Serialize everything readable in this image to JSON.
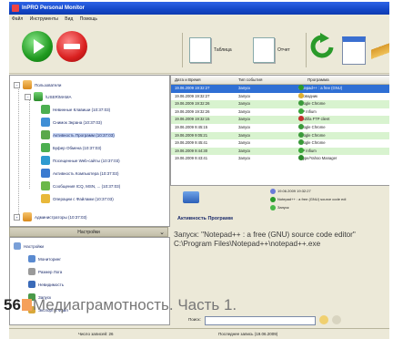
{
  "window": {
    "title": "InPRO Personal Monitor"
  },
  "menu": [
    "Файл",
    "Инструменты",
    "Вид",
    "Помощь"
  ],
  "toolbar": {
    "table_label": "Таблица",
    "report_label": "Отчет"
  },
  "tree": {
    "root": "Пользователи",
    "user": "\\USER\\МАМА",
    "items": [
      "Невинные Клавиши (10:37:03)",
      "Снимок Экрана (10:37:03)",
      "Активность Программ (10:37:03)",
      "Буфер Обмена (10:37:03)",
      "Посещенные Web-сайты (10:37:03)",
      "Активность Компьютера (10:37:03)",
      "Сообщения ICQ, MSN, ... (10:37:03)",
      "Операции с Файлами (10:37:03)"
    ],
    "admin": "Администраторы (10:37:03)"
  },
  "grid": {
    "columns": [
      "Дата и Время",
      "Тип события",
      "Программа"
    ],
    "rows": [
      {
        "date": "19.06.2009 19:32:27",
        "type": "Запуск",
        "program": "Notepad++ : a free (GNU)",
        "color": "#2a9a2a",
        "selected": true
      },
      {
        "date": "19.06.2009 19:32:27",
        "type": "Запуск",
        "program": "Проводник",
        "color": "#e0b030"
      },
      {
        "date": "19.06.2009 19:32:26",
        "type": "Запуск",
        "program": "Google Chrome",
        "color": "#3a9a3a"
      },
      {
        "date": "19.06.2009 19:32:26",
        "type": "Запуск",
        "program": "QIP Infium",
        "color": "#3aa83a"
      },
      {
        "date": "19.06.2009 19:32:15",
        "type": "Запуск",
        "program": "FileZilla FTP client",
        "color": "#c83030"
      },
      {
        "date": "19.06.2009 9:45:15",
        "type": "Запуск",
        "program": "Google Chrome",
        "color": "#3a9a3a"
      },
      {
        "date": "19.06.2009 9:05:21",
        "type": "Запуск",
        "program": "Google Chrome",
        "color": "#3a9a3a"
      },
      {
        "date": "19.06.2009 9:45:41",
        "type": "Запуск",
        "program": "Google Chrome",
        "color": "#3a9a3a"
      },
      {
        "date": "19.06.2009 9:44:30",
        "type": "Запуск",
        "program": "QIP Infium",
        "color": "#3aa83a"
      },
      {
        "date": "19.06.2009 9:43:41",
        "type": "Запуск",
        "program": "Skype/Yahoo Manager",
        "color": "#2a8a2a"
      }
    ]
  },
  "detail": {
    "datetime": "19.06.2009 19:32:27",
    "program": "Notepad++ : a free (GNU) source code edi",
    "event": "Запуск",
    "section_title": "Активность Программ"
  },
  "settings": {
    "header": "Настройки",
    "items": [
      "Настройки",
      "Мониторинг",
      "Размер Лога",
      "Невидимость",
      "Запуск",
      "Экспорт в Файл"
    ]
  },
  "log": {
    "line1": "Запуск: \"Notepad++ : a free (GNU) source code editor\"",
    "line2": "C:\\Program Files\\Notepad++\\notepad++.exe"
  },
  "caption": {
    "page": "56",
    "text": "Медиаграмотность. Часть 1."
  },
  "filter": {
    "label": "Поиск:"
  },
  "status": {
    "records": "Число записей: 26",
    "last": "Последнее запись (19.06.2009)"
  },
  "colors": {
    "selected_row": "#2f6fd4",
    "row_green": "#d8f3cf"
  }
}
